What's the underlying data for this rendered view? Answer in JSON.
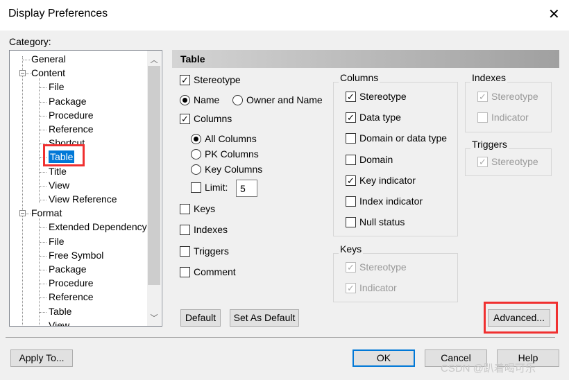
{
  "window": {
    "title": "Display Preferences",
    "close_icon": "close-icon"
  },
  "category_label": "Category:",
  "tree": [
    {
      "label": "General",
      "level": 0
    },
    {
      "label": "Content",
      "level": 0,
      "expander": "minus"
    },
    {
      "label": "File",
      "level": 1
    },
    {
      "label": "Package",
      "level": 1
    },
    {
      "label": "Procedure",
      "level": 1
    },
    {
      "label": "Reference",
      "level": 1
    },
    {
      "label": "Shortcut",
      "level": 1
    },
    {
      "label": "Table",
      "level": 1,
      "selected": true
    },
    {
      "label": "Title",
      "level": 1
    },
    {
      "label": "View",
      "level": 1
    },
    {
      "label": "View Reference",
      "level": 1
    },
    {
      "label": "Format",
      "level": 0,
      "expander": "minus"
    },
    {
      "label": "Extended Dependency",
      "level": 1
    },
    {
      "label": "File",
      "level": 1
    },
    {
      "label": "Free Symbol",
      "level": 1
    },
    {
      "label": "Package",
      "level": 1
    },
    {
      "label": "Procedure",
      "level": 1
    },
    {
      "label": "Reference",
      "level": 1
    },
    {
      "label": "Table",
      "level": 1
    },
    {
      "label": "View",
      "level": 1
    }
  ],
  "panel": {
    "title": "Table",
    "main_options": [
      {
        "type": "checkbox",
        "label": "Stereotype",
        "checked": true
      },
      {
        "type": "radio",
        "label": "Name",
        "checked": true
      },
      {
        "type": "radio",
        "label": "Owner and Name",
        "checked": false
      },
      {
        "type": "checkbox",
        "label": "Columns",
        "checked": true
      },
      {
        "type": "radio",
        "label": "All Columns",
        "checked": true
      },
      {
        "type": "radio",
        "label": "PK Columns",
        "checked": false
      },
      {
        "type": "radio",
        "label": "Key Columns",
        "checked": false
      },
      {
        "type": "checkbox",
        "label": "Limit:",
        "checked": false
      },
      {
        "type": "checkbox",
        "label": "Keys",
        "checked": false
      },
      {
        "type": "checkbox",
        "label": "Indexes",
        "checked": false
      },
      {
        "type": "checkbox",
        "label": "Triggers",
        "checked": false
      },
      {
        "type": "checkbox",
        "label": "Comment",
        "checked": false
      }
    ],
    "limit_value": "5",
    "groups": [
      {
        "title": "Columns",
        "items": [
          {
            "label": "Stereotype",
            "checked": true,
            "disabled": false
          },
          {
            "label": "Data type",
            "checked": true,
            "disabled": false
          },
          {
            "label": "Domain or data type",
            "checked": false,
            "disabled": false
          },
          {
            "label": "Domain",
            "checked": false,
            "disabled": false
          },
          {
            "label": "Key indicator",
            "checked": true,
            "disabled": false
          },
          {
            "label": "Index indicator",
            "checked": false,
            "disabled": false
          },
          {
            "label": "Null status",
            "checked": false,
            "disabled": false
          }
        ]
      },
      {
        "title": "Keys",
        "items": [
          {
            "label": "Stereotype",
            "checked": true,
            "disabled": true
          },
          {
            "label": "Indicator",
            "checked": true,
            "disabled": true
          }
        ]
      },
      {
        "title": "Indexes",
        "items": [
          {
            "label": "Stereotype",
            "checked": true,
            "disabled": true
          },
          {
            "label": "Indicator",
            "checked": false,
            "disabled": true
          }
        ]
      },
      {
        "title": "Triggers",
        "items": [
          {
            "label": "Stereotype",
            "checked": true,
            "disabled": true
          }
        ]
      }
    ],
    "buttons": {
      "default": "Default",
      "set_as_default": "Set As Default",
      "advanced": "Advanced..."
    }
  },
  "footer": {
    "apply_to": "Apply To...",
    "ok": "OK",
    "cancel": "Cancel",
    "help": "Help"
  },
  "watermark": "CSDN @趴着喝可乐",
  "colors": {
    "selection": "#0078d7",
    "highlight_box": "#f03030",
    "default_button_border": "#0078d7"
  }
}
